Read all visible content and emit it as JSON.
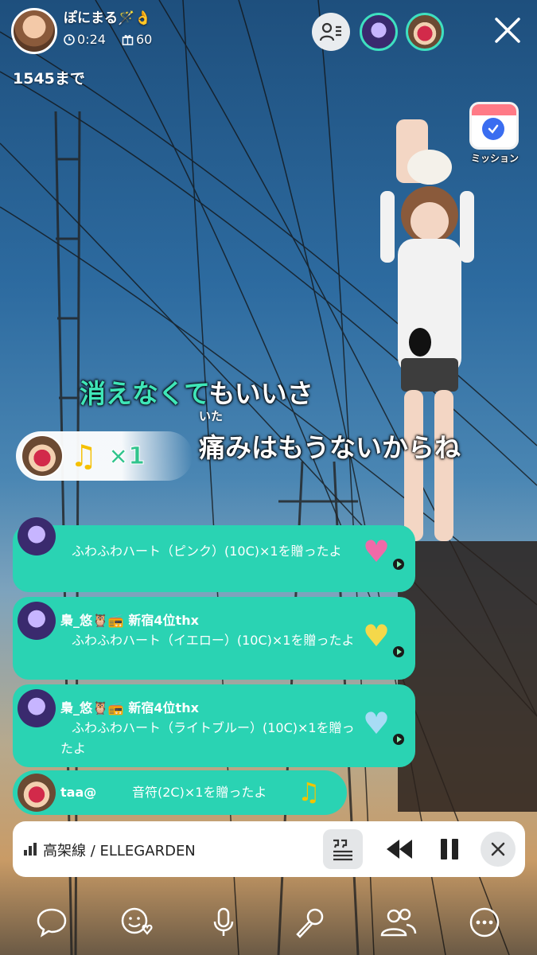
{
  "host": {
    "name": "ぽにまる",
    "name_emoji": "🪄👌",
    "elapsed": "0:24",
    "gift_points": "60",
    "goal_text": "1545まで"
  },
  "mission": {
    "label": "ミッション"
  },
  "lyrics": {
    "line1_sung": "消えなくて",
    "line1_rest": "もいいさ",
    "line2_ruby": "いた",
    "line2": "痛みはもうないからね"
  },
  "gift_banner": {
    "notes": "♫",
    "count": "×1"
  },
  "comments": [
    {
      "name": "",
      "text": "ふわふわハート（ピンク）(10C)×1を贈ったよ",
      "gift_icon": "heart-pink-icon"
    },
    {
      "name": "梟_悠🦉📻 新宿4位thx",
      "text": "ふわふわハート（イエロー）(10C)×1を贈ったよ",
      "gift_icon": "heart-yellow-icon"
    },
    {
      "name": "梟_悠🦉📻 新宿4位thx",
      "text": "ふわふわハート（ライトブルー）(10C)×1を贈ったよ",
      "gift_icon": "heart-lightblue-icon"
    },
    {
      "name": "taa@",
      "text": "音符(2C)×1を贈ったよ",
      "gift_icon": "music-note-icon"
    }
  ],
  "player": {
    "track": "高架線 / ELLEGARDEN"
  },
  "colors": {
    "accent": "#2ad3b3",
    "lyric_sung": "#3fe6b8",
    "count_green": "#31c48d"
  }
}
